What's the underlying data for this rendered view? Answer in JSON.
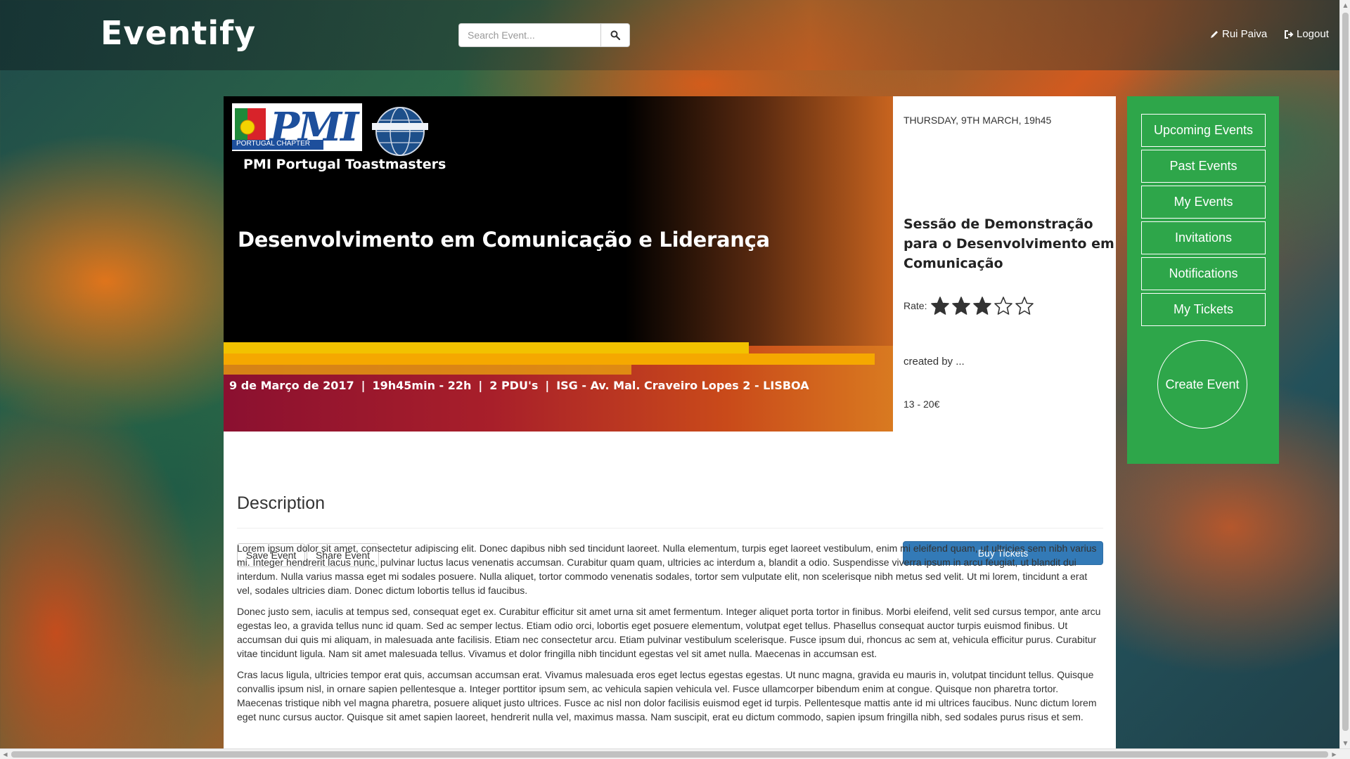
{
  "navbar": {
    "brand": "Eventify",
    "search_placeholder": "Search Event...",
    "user_name": "Rui Paiva",
    "logout_label": "Logout",
    "icons": {
      "search": "search-icon",
      "user": "pencil-icon",
      "logout": "logout-icon"
    }
  },
  "event": {
    "banner": {
      "org_letters": "PMI",
      "org_chapter": "PORTUGAL CHAPTER",
      "subtitle": "PMI Portugal Toastmasters",
      "title": "Desenvolvimento em Comunicação e Liderança",
      "info": [
        "9 de Março de  2017",
        "19h45min - 22h",
        "2 PDU's",
        "ISG - Av. Mal. Craveiro Lopes 2 - LISBOA"
      ]
    },
    "date": "THURSDAY, 9TH MARCH, 19h45",
    "title": "Sessão de Demonstração para o Desenvolvimento em Comunicação",
    "rate_label": "Rate:",
    "rating": 3,
    "rating_max": 5,
    "created_by": "created by ...",
    "price": "13 - 20€"
  },
  "actions": {
    "save_label": "Save Event",
    "share_label": "Share Event",
    "buy_label": "Buy Tickets"
  },
  "description": {
    "heading": "Description",
    "paragraphs": [
      "Lorem ipsum dolor sit amet, consectetur adipiscing elit. Donec dapibus nibh sed tincidunt laoreet. Nulla elementum, turpis eget laoreet vestibulum, enim mi eleifend quam, ut ultricies sem nibh varius mi. Integer hendrerit lacus nunc, pulvinar luctus lacus venenatis accumsan. Curabitur quam quam, ultricies ac interdum a, blandit a odio. Suspendisse viverra ipsum in arcu feugiat, ut blandit dui interdum. Nulla varius massa eget mi sodales posuere. Nulla aliquet, tortor commodo venenatis sodales, tortor sem vulputate elit, non scelerisque nibh metus sed velit. Ut mi lorem, tincidunt a erat vel, sodales ultricies diam. Donec dictum lobortis tellus id faucibus.",
      "Donec justo sem, iaculis at tempus sed, consequat eget ex. Curabitur efficitur sit amet urna sit amet fermentum. Integer aliquet porta tortor in finibus. Morbi eleifend, velit sed cursus tempor, ante arcu egestas leo, a gravida tellus nunc id quam. Sed ac semper lectus. Etiam odio orci, lobortis eget posuere elementum, volutpat eget tellus. Phasellus consequat auctor turpis euismod finibus. Ut accumsan dui quis mi aliquam, in malesuada ante facilisis. Etiam nec consectetur arcu. Etiam pulvinar vestibulum scelerisque. Fusce ipsum dui, rhoncus ac sem at, vehicula efficitur purus. Curabitur vitae tincidunt ligula. Nam sit amet malesuada tellus. Vivamus et dolor fringilla nibh tincidunt egestas vel sit amet nulla. Maecenas in accumsan est.",
      "Cras lacus ligula, ultricies tempor erat quis, accumsan accumsan erat. Vivamus malesuada eros eget lectus egestas egestas. Ut nunc magna, gravida eu mauris in, volutpat tincidunt tellus. Quisque convallis ipsum nisl, in ornare sapien pellentesque a. Integer porttitor ipsum sem, ac vehicula sapien vehicula vel. Fusce ullamcorper bibendum enim at congue. Quisque non pharetra tortor. Maecenas tristique nibh vel magna pharetra, posuere aliquet justo ultrices. Fusce ac nisl non dolor facilisis euismod eget id turpis. Pellentesque mattis ante id mi ultrices faucibus. Nunc dictum lorem eget nunc cursus auctor. Quisque sit amet sapien laoreet, hendrerit nulla vel, maximus massa. Nam suscipit, erat eu dictum commodo, sapien ipsum fringilla nibh, sed sodales purus risus et sem."
    ]
  },
  "sidebar": {
    "items": [
      {
        "label": "Upcoming Events"
      },
      {
        "label": "Past Events"
      },
      {
        "label": "My Events"
      },
      {
        "label": "Invitations"
      },
      {
        "label": "Notifications"
      },
      {
        "label": "My Tickets"
      }
    ],
    "create_label": "Create Event"
  },
  "colors": {
    "sidebar_green": "#2ea64a",
    "primary_blue": "#337ab7"
  }
}
